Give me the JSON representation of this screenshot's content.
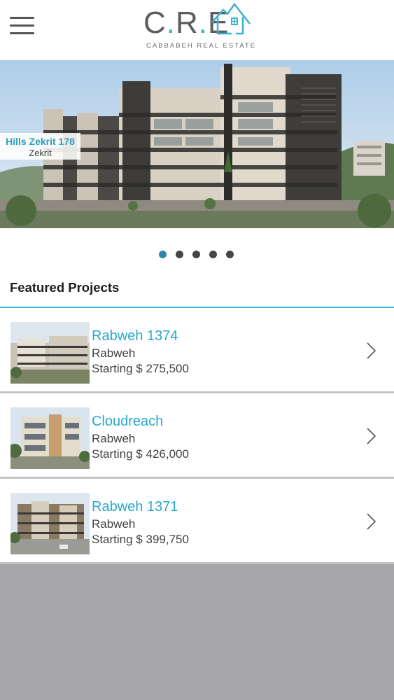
{
  "header": {
    "logo_letters": [
      "C",
      ".",
      "R",
      ".",
      "E"
    ],
    "logo_tagline": "CABBABEH REAL ESTATE"
  },
  "hero": {
    "title": "Hills Zekrit 178",
    "subtitle": "Zekrit",
    "slide_count": 5,
    "active_slide": 1
  },
  "featured": {
    "heading": "Featured Projects"
  },
  "projects": [
    {
      "name": "Rabweh 1374",
      "location": "Rabweh",
      "price": "Starting $ 275,500"
    },
    {
      "name": "Cloudreach",
      "location": "Rabweh",
      "price": "Starting $ 426,000"
    },
    {
      "name": "Rabweh 1371",
      "location": "Rabweh",
      "price": "Starting $ 399,750"
    }
  ],
  "colors": {
    "accent": "#29a8cc",
    "divider": "#41bbd6",
    "active_dot": "#2f86a6",
    "footer_gray": "#a7a7a9"
  },
  "icons": {
    "menu": "hamburger-icon",
    "chevron": "chevron-right-icon",
    "logo_house": "house-outline-icon"
  }
}
